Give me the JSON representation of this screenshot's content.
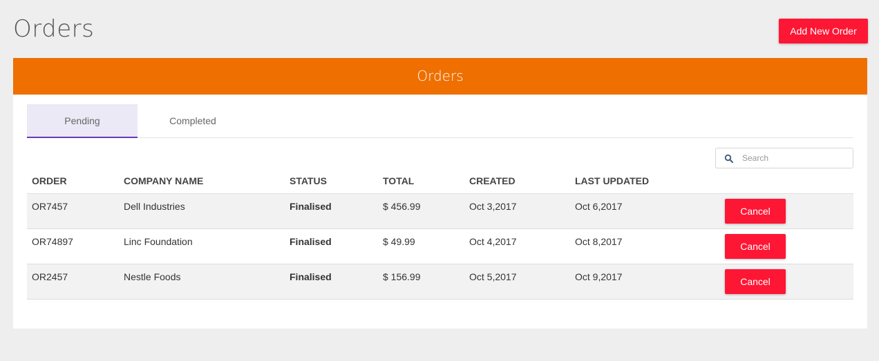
{
  "page": {
    "title": "Orders",
    "add_button_label": "Add New Order"
  },
  "card": {
    "header_title": "Orders",
    "tabs": [
      {
        "label": "Pending",
        "active": true
      },
      {
        "label": "Completed",
        "active": false
      }
    ],
    "search": {
      "placeholder": "Search",
      "value": ""
    }
  },
  "table": {
    "columns": [
      "ORDER",
      "COMPANY NAME",
      "STATUS",
      "TOTAL",
      "CREATED",
      "LAST UPDATED"
    ],
    "rows": [
      {
        "order": "OR7457",
        "company": "Dell Industries",
        "status": "Finalised",
        "total": "$ 456.99",
        "created": "Oct 3,2017",
        "updated": "Oct 6,2017",
        "action": "Cancel"
      },
      {
        "order": "OR74897",
        "company": "Linc Foundation",
        "status": "Finalised",
        "total": "$ 49.99",
        "created": "Oct 4,2017",
        "updated": "Oct 8,2017",
        "action": "Cancel"
      },
      {
        "order": "OR2457",
        "company": "Nestle Foods",
        "status": "Finalised",
        "total": "$ 156.99",
        "created": "Oct 5,2017",
        "updated": "Oct 9,2017",
        "action": "Cancel"
      }
    ]
  },
  "colors": {
    "accent_header": "#ef6f00",
    "button_red": "#fe1635",
    "tab_indicator": "#673ab7"
  },
  "icons": {
    "search": "search-icon"
  }
}
